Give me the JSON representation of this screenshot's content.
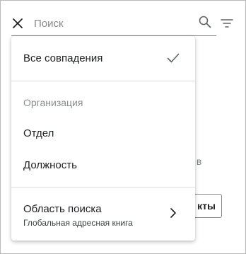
{
  "search": {
    "placeholder": "Поиск"
  },
  "background": {
    "partial_text": "те в",
    "partial_button_label": "кты"
  },
  "menu": {
    "all_matches": {
      "label": "Все совпадения",
      "selected": true
    },
    "section_header": "Организация",
    "items": [
      {
        "label": "Отдел"
      },
      {
        "label": "Должность"
      }
    ],
    "search_scope": {
      "label": "Область поиска",
      "value": "Глобальная адресная книга"
    }
  },
  "colors": {
    "text_primary": "#202124",
    "text_secondary": "#8a8d91",
    "divider": "#dcdcdc",
    "icon": "#5f6368"
  },
  "icons": [
    "close-icon",
    "search-icon",
    "filter-icon",
    "check-icon",
    "chevron-right-icon"
  ]
}
